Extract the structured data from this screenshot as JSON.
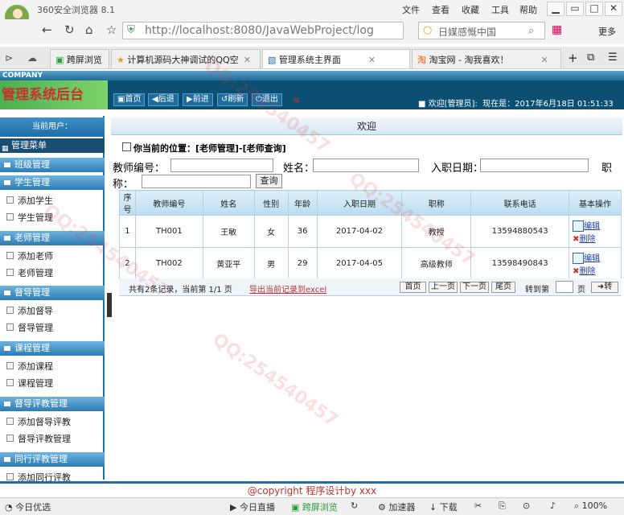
{
  "browser": {
    "title": "360安全浏览器 8.1",
    "menus": [
      "文件",
      "查看",
      "收藏",
      "工具",
      "帮助"
    ],
    "url": "http://localhost:8080/JavaWebProject/login/loc",
    "search": "日媒感慨中国",
    "more": "更多",
    "tabs": [
      {
        "label": "跨屏浏览"
      },
      {
        "label": "计算机源码大神调试的QQ空"
      },
      {
        "label": "管理系统主界面"
      },
      {
        "label": "淘宝网 - 淘我喜欢！"
      }
    ]
  },
  "app": {
    "company": "COMPANY",
    "logo": "管理系统后台",
    "nav": [
      "首页",
      "后退",
      "前进",
      "刷新",
      "退出"
    ],
    "welcome": "欢迎[管理员]:",
    "now": "现在是：2017年6月18日 01:51:33"
  },
  "sidebar": {
    "current_user": "当前用户：",
    "menu_header": "管理菜单",
    "groups": [
      {
        "title": "班级管理",
        "items": []
      },
      {
        "title": "学生管理",
        "items": [
          "添加学生",
          "学生管理"
        ]
      },
      {
        "title": "老师管理",
        "items": [
          "添加老师",
          "老师管理"
        ]
      },
      {
        "title": "督导管理",
        "items": [
          "添加督导",
          "督导管理"
        ]
      },
      {
        "title": "课程管理",
        "items": [
          "添加课程",
          "课程管理"
        ]
      },
      {
        "title": "督导评教管理",
        "items": [
          "添加督导评教",
          "督导评教管理"
        ]
      },
      {
        "title": "同行评教管理",
        "items": [
          "添加同行评教"
        ]
      }
    ]
  },
  "main": {
    "header": "欢迎",
    "crumb": "你当前的位置：[老师管理]-[老师查询]",
    "search": {
      "teacher_no": "教师编号：",
      "name": "姓名：",
      "hire_date": "入职日期：",
      "title_a": "职",
      "title_b": "称：",
      "query": "查询"
    },
    "columns": [
      "序号",
      "教师编号",
      "姓名",
      "性别",
      "年龄",
      "入职日期",
      "职称",
      "联系电话",
      "基本操作"
    ],
    "rows": [
      [
        "1",
        "TH001",
        "王敏",
        "女",
        "36",
        "2017-04-02",
        "教授",
        "13594880543"
      ],
      [
        "2",
        "TH002",
        "黄亚平",
        "男",
        "29",
        "2017-04-05",
        "高级教师",
        "13598490843"
      ]
    ],
    "ops": {
      "edit": "编辑",
      "delete": "删除"
    },
    "pager": {
      "summary": "共有2条记录，当前第 1/1 页",
      "export": "导出当前记录到excel",
      "buttons": [
        "首页",
        "上一页",
        "下一页",
        "尾页"
      ],
      "goto": "转到第",
      "page": "页",
      "go": "转"
    }
  },
  "footer": "@copyright  程序设计by xxx",
  "statusbar": [
    "今日优选",
    "今日直播",
    "跨屏浏览",
    "加速器",
    "下载",
    "100%"
  ],
  "watermark": "QQ:254540457"
}
